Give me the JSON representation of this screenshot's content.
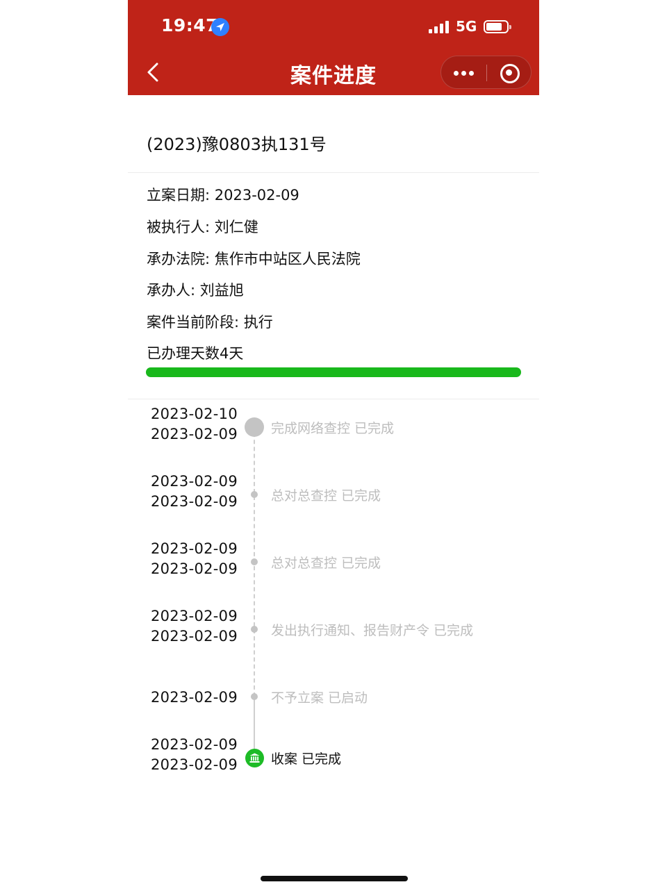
{
  "status_bar": {
    "time": "19:47",
    "network": "5G"
  },
  "header": {
    "title": "案件进度"
  },
  "case": {
    "number": "(2023)豫0803执131号",
    "filing_date": "立案日期:  2023-02-09",
    "respondent": "被执行人:  刘仁健",
    "court": "承办法院:  焦作市中站区人民法院",
    "handler": "承办人:  刘益旭",
    "stage": "案件当前阶段:  执行",
    "days_text": "已办理天数4天",
    "progress_percent": 100
  },
  "timeline": [
    {
      "date_top": "2023-02-10",
      "date_bottom": "2023-02-09",
      "text": "完成网络查控 已完成"
    },
    {
      "date_top": "2023-02-09",
      "date_bottom": "2023-02-09",
      "text": "总对总查控 已完成"
    },
    {
      "date_top": "2023-02-09",
      "date_bottom": "2023-02-09",
      "text": "总对总查控 已完成"
    },
    {
      "date_top": "2023-02-09",
      "date_bottom": "2023-02-09",
      "text": "发出执行通知、报告财产令 已完成"
    },
    {
      "date_single": "2023-02-09",
      "text": "不予立案 已启动"
    },
    {
      "date_top": "2023-02-09",
      "date_bottom": "2023-02-09",
      "text": "收案 已完成"
    }
  ],
  "colors": {
    "header_bg": "#bf2318",
    "progress": "#19b81c",
    "active_node": "#1dbb26",
    "muted_text": "#bdbdbd"
  },
  "icons": {
    "location": "location-arrow-icon",
    "court_node": "court-building-icon"
  }
}
